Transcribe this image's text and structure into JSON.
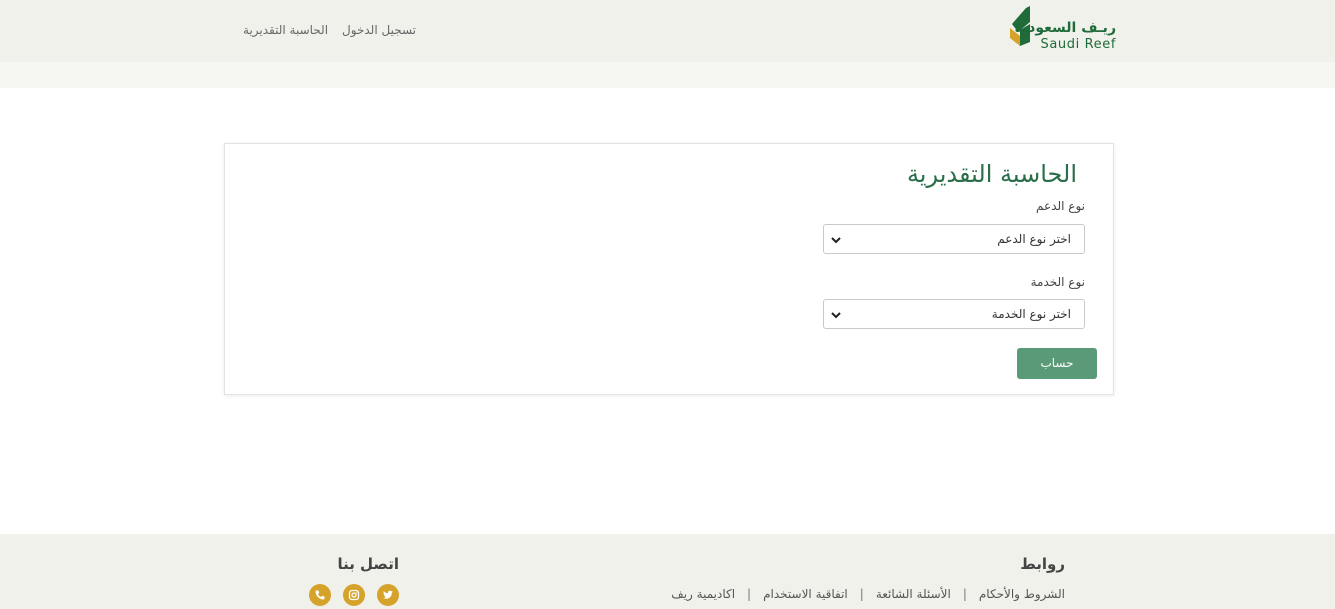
{
  "header": {
    "logo": {
      "text_ar": "ريـف السعودية",
      "text_en": "Saudi Reef"
    },
    "nav": [
      {
        "label": "تسجيل الدخول"
      },
      {
        "label": "الحاسبة التقديرية"
      }
    ]
  },
  "form": {
    "title": "الحاسبة التقديرية",
    "support_type": {
      "label": "نوع الدعم",
      "selected": "اختر نوع الدعم"
    },
    "service_type": {
      "label": "نوع الخدمة",
      "selected": "اختر نوع الخدمة"
    },
    "submit_label": "حساب"
  },
  "footer": {
    "links_heading": "روابط",
    "links": [
      {
        "label": "الشروط والأحكام"
      },
      {
        "label": "الأسئلة الشائعة"
      },
      {
        "label": "اتفاقية الاستخدام"
      },
      {
        "label": "اكاديمية ريف"
      }
    ],
    "separator": "|",
    "contact_heading": "اتصل بنا",
    "social": [
      {
        "icon": "twitter-icon"
      },
      {
        "icon": "instagram-icon"
      },
      {
        "icon": "phone-icon"
      }
    ]
  },
  "colors": {
    "brand_green": "#1f6b3a",
    "button_green": "#5a9a78",
    "accent_gold": "#d5a22a",
    "header_bg": "#f1f1ec"
  }
}
